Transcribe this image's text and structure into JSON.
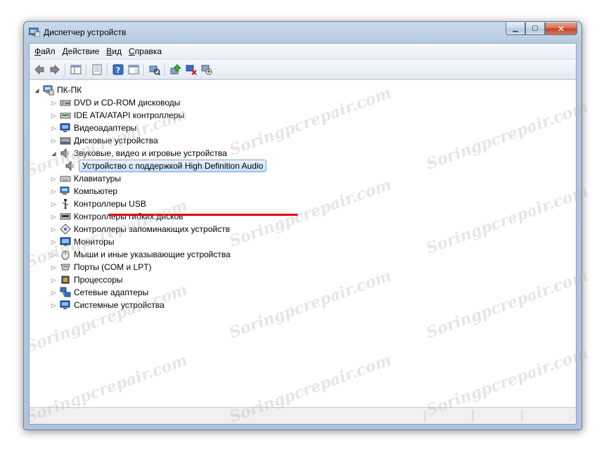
{
  "window": {
    "title": "Диспетчер устройств"
  },
  "menu": [
    {
      "label": "Файл",
      "accel": "Ф",
      "rest": "айл"
    },
    {
      "label": "Действие",
      "accel": "Д",
      "rest": "ействие"
    },
    {
      "label": "Вид",
      "accel": "В",
      "rest": "ид"
    },
    {
      "label": "Справка",
      "accel": "С",
      "rest": "правка"
    }
  ],
  "toolbar": {
    "buttons": [
      "back-icon",
      "forward-icon",
      "console-tree-icon",
      "properties-icon",
      "help-icon",
      "action-pane-icon",
      "scan-hardware-icon",
      "update-driver-icon",
      "disable-device-icon",
      "uninstall-device-icon"
    ]
  },
  "tree": {
    "root": "ПК-ПК",
    "categories": [
      {
        "label": "DVD и CD-ROM дисководы",
        "icon": "dvd-drive-icon"
      },
      {
        "label": "IDE ATA/ATAPI контроллеры",
        "icon": "ide-controller-icon"
      },
      {
        "label": "Видеоадаптеры",
        "icon": "display-adapter-icon"
      },
      {
        "label": "Дисковые устройства",
        "icon": "disk-drive-icon"
      },
      {
        "label": "Звуковые, видео и игровые устройства",
        "icon": "speaker-icon",
        "expanded": true
      },
      {
        "label": "Устройство с поддержкой High Definition Audio",
        "icon": "speaker-icon",
        "child": true,
        "selected": true
      },
      {
        "label": "Клавиатуры",
        "icon": "keyboard-icon"
      },
      {
        "label": "Компьютер",
        "icon": "computer-icon"
      },
      {
        "label": "Контроллеры USB",
        "icon": "usb-icon"
      },
      {
        "label": "Контроллеры гибких дисков",
        "icon": "floppy-controller-icon"
      },
      {
        "label": "Контроллеры запоминающих устройств",
        "icon": "storage-controller-icon"
      },
      {
        "label": "Мониторы",
        "icon": "monitor-icon"
      },
      {
        "label": "Мыши и иные указывающие устройства",
        "icon": "mouse-icon"
      },
      {
        "label": "Порты (COM и LPT)",
        "icon": "port-icon"
      },
      {
        "label": "Процессоры",
        "icon": "processor-icon"
      },
      {
        "label": "Сетевые адаптеры",
        "icon": "network-adapter-icon"
      },
      {
        "label": "Системные устройства",
        "icon": "system-devices-icon"
      }
    ]
  },
  "watermark": "Soringpcrepair.com",
  "colors": {
    "frame": "#b6cbe0",
    "selection": "#c6dcf5",
    "annotation": "#e00000"
  }
}
